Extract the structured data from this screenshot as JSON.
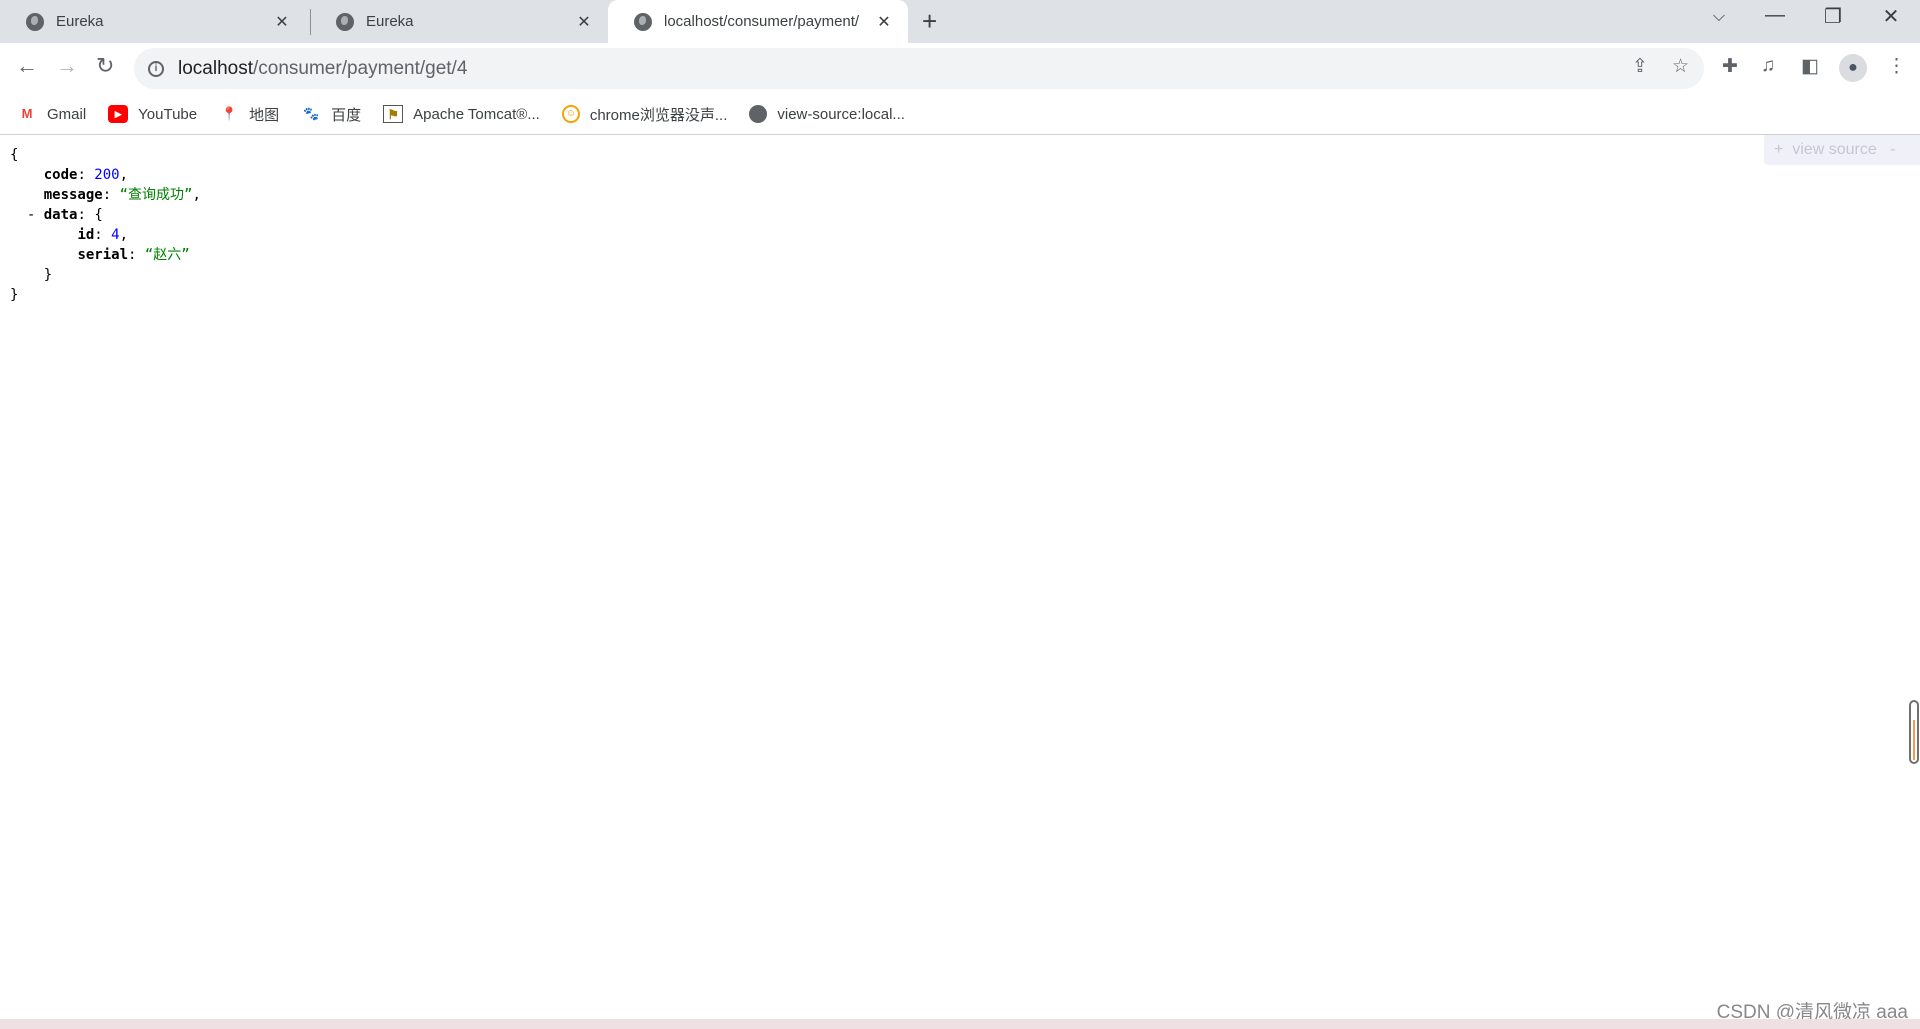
{
  "tabs": [
    {
      "title": "Eureka",
      "active": false
    },
    {
      "title": "Eureka",
      "active": false
    },
    {
      "title": "localhost/consumer/payment/",
      "active": true
    }
  ],
  "address": {
    "host": "localhost",
    "path": "/consumer/payment/get/4"
  },
  "bookmarks": [
    {
      "label": "Gmail",
      "icon": "gmail-icon"
    },
    {
      "label": "YouTube",
      "icon": "youtube-icon"
    },
    {
      "label": "地图",
      "icon": "maps-pin-icon"
    },
    {
      "label": "百度",
      "icon": "baidu-paw-icon"
    },
    {
      "label": "Apache Tomcat®...",
      "icon": "tomcat-icon"
    },
    {
      "label": "chrome浏览器没声...",
      "icon": "smiley-icon"
    },
    {
      "label": "view-source:local...",
      "icon": "globe-icon"
    }
  ],
  "json": {
    "open": "{",
    "close": "}",
    "code_key": "code",
    "code_val": "200",
    "message_key": "message",
    "message_val": "“查询成功”",
    "collapse": "-",
    "data_key": "data",
    "data_open": "{",
    "data_close": "}",
    "id_key": "id",
    "id_val": "4",
    "serial_key": "serial",
    "serial_val": "“赵六”"
  },
  "view_source": {
    "plus": "+",
    "label": "view source",
    "minus": "-"
  },
  "watermark": "CSDN @清风微凉 aaa",
  "colors": {
    "number": "#0000ff",
    "string": "#008000",
    "tabbar": "#dee1e6"
  }
}
